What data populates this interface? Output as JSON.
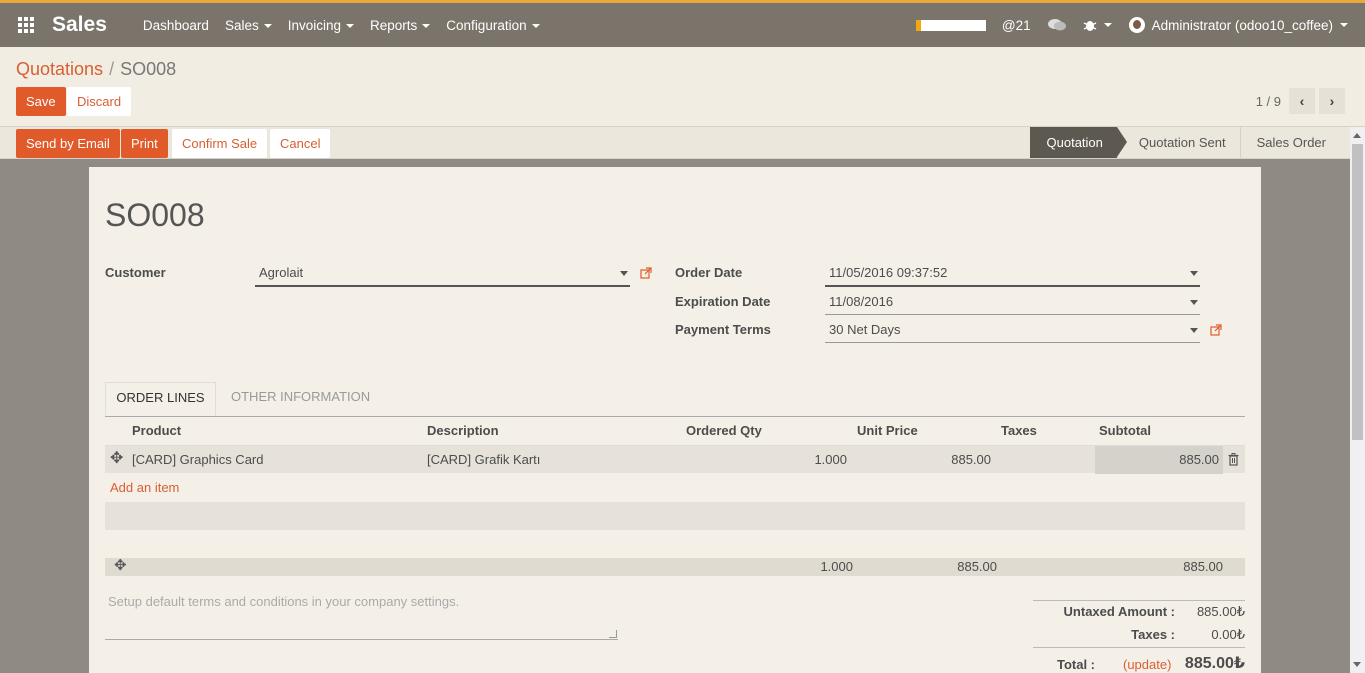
{
  "topbar": {
    "app_name": "Sales",
    "menu": [
      "Dashboard",
      "Sales",
      "Invoicing",
      "Reports",
      "Configuration"
    ],
    "progress_fraction": 0.07,
    "mentions": "@21",
    "user": "Administrator (odoo10_coffee)"
  },
  "breadcrumb": {
    "parent": "Quotations",
    "separator": "/",
    "current": "SO008"
  },
  "actions": {
    "save": "Save",
    "discard": "Discard"
  },
  "pager": {
    "value": "1 / 9"
  },
  "statusbar": {
    "buttons": {
      "send": "Send by Email",
      "print": "Print",
      "confirm": "Confirm Sale",
      "cancel": "Cancel"
    },
    "stages": [
      "Quotation",
      "Quotation Sent",
      "Sales Order"
    ],
    "active_stage": "Quotation"
  },
  "form": {
    "title": "SO008",
    "customer_label": "Customer",
    "customer_value": "Agrolait",
    "order_date_label": "Order Date",
    "order_date_value": "11/05/2016 09:37:52",
    "expiration_label": "Expiration Date",
    "expiration_value": "11/08/2016",
    "payment_terms_label": "Payment Terms",
    "payment_terms_value": "30 Net Days"
  },
  "tabs": [
    "ORDER LINES",
    "OTHER INFORMATION"
  ],
  "lines": {
    "columns": [
      "Product",
      "Description",
      "Ordered Qty",
      "Unit Price",
      "Taxes",
      "Subtotal"
    ],
    "rows": [
      {
        "product": "[CARD] Graphics Card",
        "description": "[CARD] Grafik Kartı",
        "qty": "1.000",
        "unit_price": "885.00",
        "taxes": "",
        "subtotal": "885.00"
      }
    ],
    "add_item": "Add an item",
    "sums": {
      "qty": "1.000",
      "unit_price": "885.00",
      "subtotal": "885.00"
    }
  },
  "terms_placeholder": "Setup default terms and conditions in your company settings.",
  "totals": {
    "untaxed_label": "Untaxed Amount :",
    "untaxed_value": "885.00₺",
    "taxes_label": "Taxes :",
    "taxes_value": "0.00₺",
    "total_label": "Total :",
    "update_link": "(update)",
    "total_value": "885.00₺"
  },
  "colors": {
    "accent": "#e15a2a",
    "topbar": "#7a746a",
    "topbar_stripe": "#e8a83a",
    "active_stage": "#5d5950"
  }
}
